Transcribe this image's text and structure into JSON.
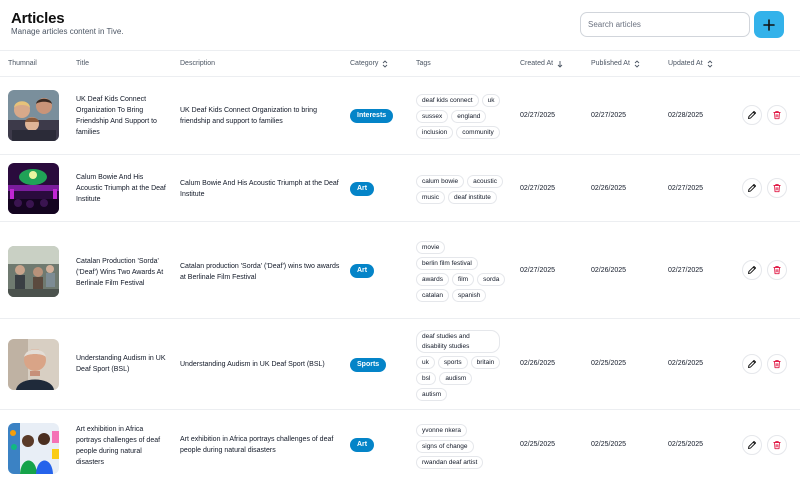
{
  "page": {
    "title": "Articles",
    "subtitle": "Manage articles content in Tive."
  },
  "search": {
    "placeholder": "Search articles",
    "value": ""
  },
  "add_button": {
    "icon": "plus-icon",
    "color": "#33b2ea"
  },
  "columns": {
    "thumbnail": "Thumnail",
    "title": "Title",
    "description": "Description",
    "category": "Category",
    "tags": "Tags",
    "created_at": "Created At",
    "published_at": "Published At",
    "updated_at": "Updated At"
  },
  "colors": {
    "badge": "#0484c8",
    "delete": "#e11d48",
    "accent": "#33b2ea"
  },
  "rows": [
    {
      "title": "UK Deaf Kids Connect Organization To Bring Friendship And Support to families",
      "description": "UK Deaf Kids Connect Organization to bring friendship and support to families",
      "category": "Interests",
      "tags": [
        "deaf kids connect",
        "uk",
        "sussex",
        "england",
        "inclusion",
        "community"
      ],
      "created_at": "02/27/2025",
      "published_at": "02/27/2025",
      "updated_at": "02/28/2025"
    },
    {
      "title": "Calum Bowie And His Acoustic Triumph at the Deaf Institute",
      "description": "Calum Bowie And His Acoustic Triumph at the Deaf Institute",
      "category": "Art",
      "tags": [
        "calum bowie",
        "acoustic",
        "music",
        "deaf institute"
      ],
      "created_at": "02/27/2025",
      "published_at": "02/26/2025",
      "updated_at": "02/27/2025"
    },
    {
      "title": "Catalan Production 'Sorda' ('Deaf') Wins Two Awards At Berlinale Film Festival",
      "description": "Catalan production 'Sorda' ('Deaf') wins two awards at Berlinale Film Festival",
      "category": "Art",
      "tags": [
        "movie",
        "berlin film festival",
        "awards",
        "film",
        "sorda",
        "catalan",
        "spanish"
      ],
      "created_at": "02/27/2025",
      "published_at": "02/26/2025",
      "updated_at": "02/27/2025"
    },
    {
      "title": "Understanding Audism in UK Deaf Sport (BSL)",
      "description": "Understanding Audism in UK Deaf Sport (BSL)",
      "category": "Sports",
      "tags": [
        "deaf studies and disability studies",
        "uk",
        "sports",
        "britain",
        "bsl",
        "audism",
        "autism"
      ],
      "created_at": "02/26/2025",
      "published_at": "02/25/2025",
      "updated_at": "02/26/2025"
    },
    {
      "title": "Art exhibition in Africa portrays challenges of deaf people during natural disasters",
      "description": "Art exhibition in Africa portrays challenges of deaf people during natural disasters",
      "category": "Art",
      "tags": [
        "yvonne nkera",
        "signs of change",
        "rwandan deaf artist"
      ],
      "created_at": "02/25/2025",
      "published_at": "02/25/2025",
      "updated_at": "02/25/2025"
    }
  ]
}
